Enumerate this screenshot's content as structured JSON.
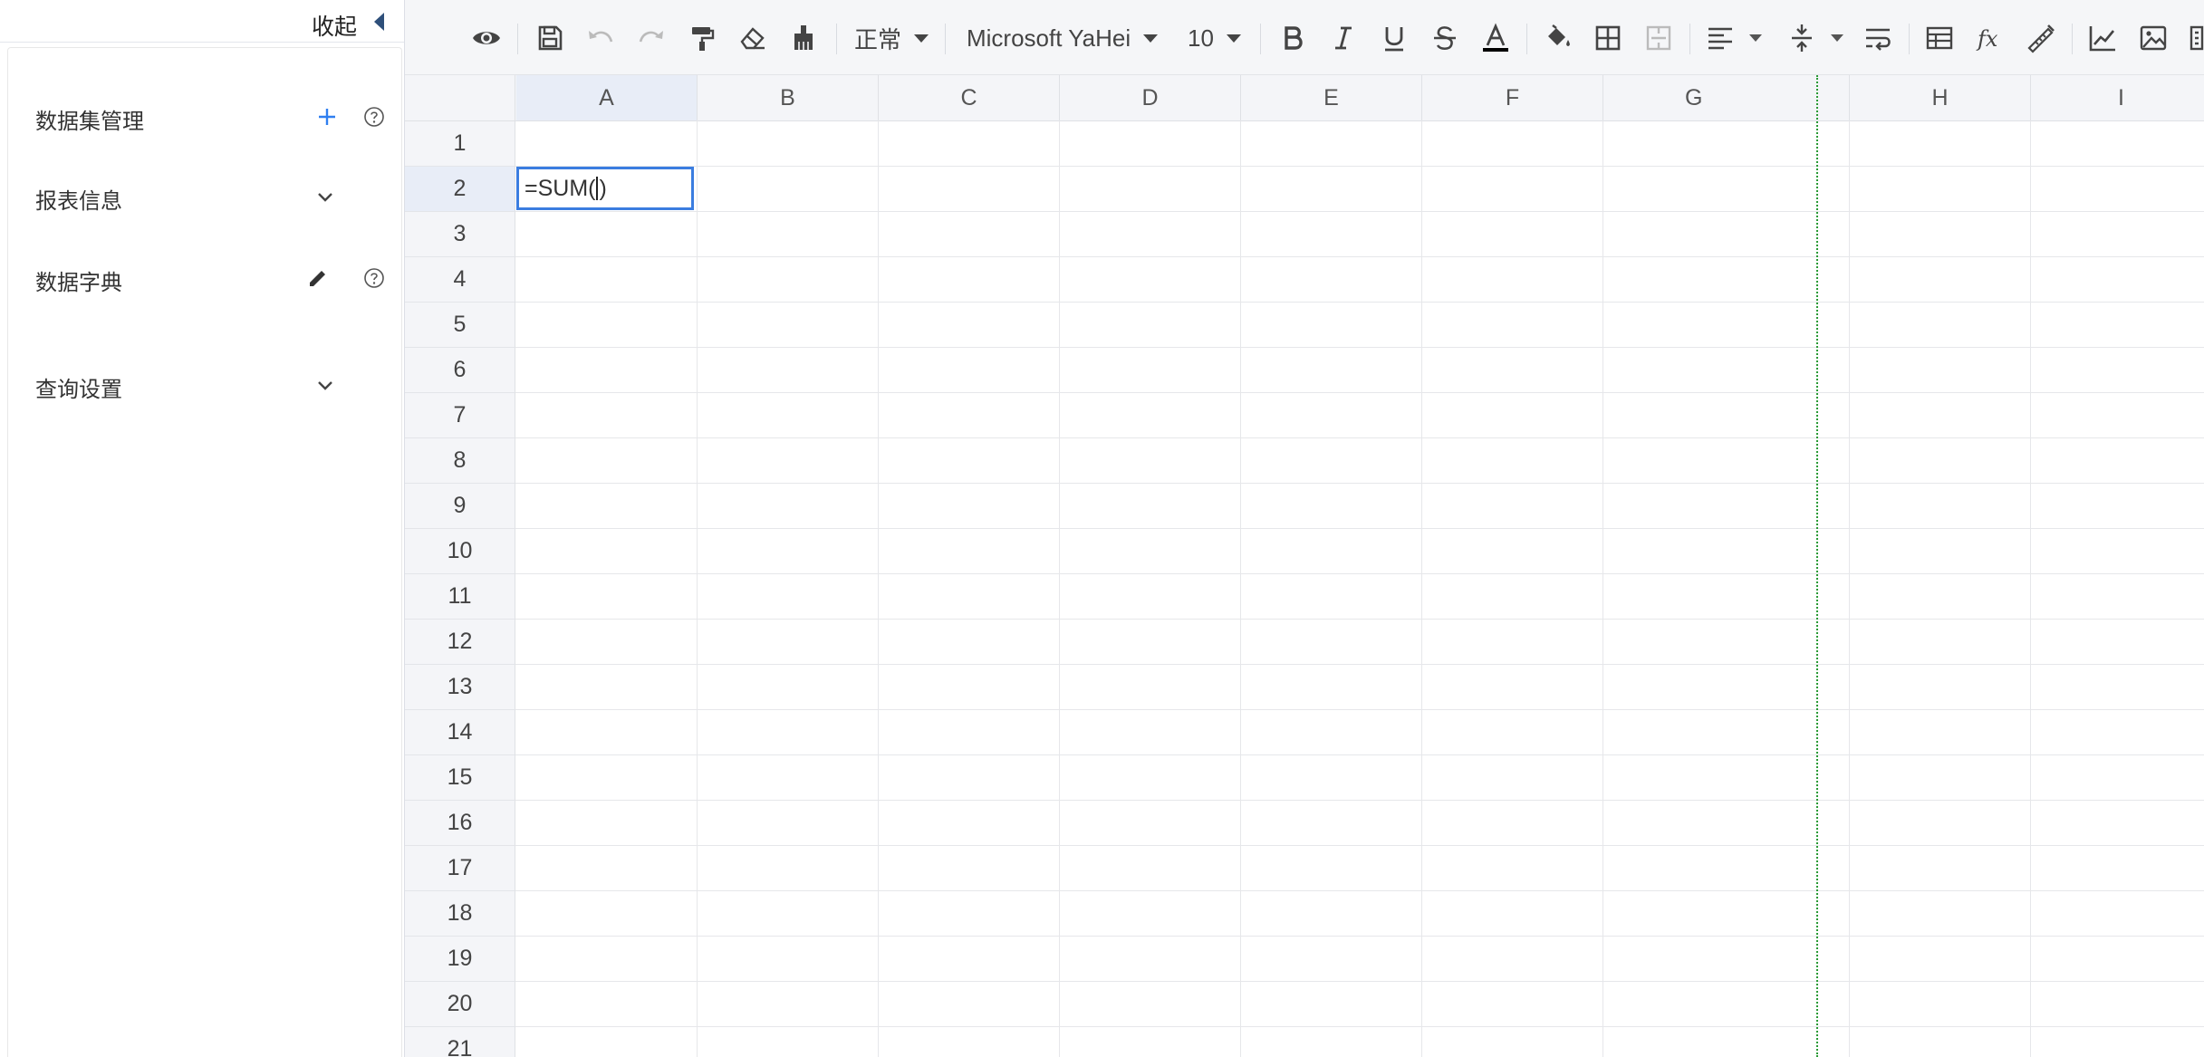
{
  "left_panel": {
    "collapse_label": "收起",
    "items": [
      {
        "label": "数据集管理"
      },
      {
        "label": "报表信息"
      },
      {
        "label": "数据字典"
      },
      {
        "label": "查询设置"
      }
    ]
  },
  "toolbar": {
    "format_select": "正常",
    "font_select": "Microsoft YaHei",
    "size_select": "10",
    "font_color": "#000000"
  },
  "sheet": {
    "columns": [
      "A",
      "B",
      "C",
      "D",
      "E",
      "F",
      "G",
      "H",
      "I"
    ],
    "rows": [
      "1",
      "2",
      "3",
      "4",
      "5",
      "6",
      "7",
      "8",
      "9",
      "10",
      "11",
      "12",
      "13",
      "14",
      "15",
      "16",
      "17",
      "18",
      "19",
      "20",
      "21"
    ],
    "active_cell": {
      "ref": "A2",
      "text_before_cursor": "=SUM(",
      "text_after_cursor": ")"
    }
  },
  "colors": {
    "accent": "#3a7de0",
    "page_break": "#2a9a35",
    "add_icon": "#2f7ff0"
  }
}
